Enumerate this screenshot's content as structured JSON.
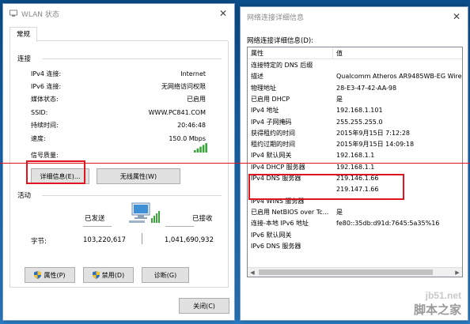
{
  "status_window": {
    "title": "WLAN 状态",
    "tab": "常规",
    "connection": {
      "title": "连接",
      "rows": [
        {
          "k": "IPv4 连接:",
          "v": "Internet"
        },
        {
          "k": "IPv6 连接:",
          "v": "无网络访问权限"
        },
        {
          "k": "媒体状态:",
          "v": "已启用"
        },
        {
          "k": "SSID:",
          "v": "WWW.PC841.COM"
        },
        {
          "k": "持续时间:",
          "v": "20:46:48"
        },
        {
          "k": "速度:",
          "v": "150.0 Mbps"
        }
      ],
      "signal_label": "信号质量:",
      "signal_bars": 5
    },
    "details_button": "详细信息(E)...",
    "wireless_props_button": "无线属性(W)",
    "activity": {
      "title": "活动",
      "sent_label": "已发送",
      "received_label": "已接收",
      "bytes_label": "字节:",
      "bytes_sent": "103,220,617",
      "bytes_received": "1,041,690,932"
    },
    "properties_button": "属性(P)",
    "disable_button": "禁用(D)",
    "diagnose_button": "诊断(G)",
    "close_button": "关闭(C)"
  },
  "details_window": {
    "title": "网络连接详细信息",
    "list_label": "网络连接详细信息(D):",
    "col_property": "属性",
    "col_value": "值",
    "rows": [
      {
        "k": "连接特定的 DNS 后缀",
        "v": ""
      },
      {
        "k": "描述",
        "v": "Qualcomm Atheros AR9485WB-EG Wire"
      },
      {
        "k": "物理地址",
        "v": "28-E3-47-42-AA-98"
      },
      {
        "k": "已启用 DHCP",
        "v": "是"
      },
      {
        "k": "IPv4 地址",
        "v": "192.168.1.101"
      },
      {
        "k": "IPv4 子网掩码",
        "v": "255.255.255.0"
      },
      {
        "k": "获得租约的时间",
        "v": "2015年9月15日 7:12:28"
      },
      {
        "k": "租约过期的时间",
        "v": "2015年9月15日 14:09:18"
      },
      {
        "k": "IPv4 默认网关",
        "v": "192.168.1.1"
      },
      {
        "k": "IPv4 DHCP 服务器",
        "v": "192.168.1.1"
      },
      {
        "k": "IPv4 DNS 服务器",
        "v": "219.146.1.66"
      },
      {
        "k": "",
        "v": "219.147.1.66"
      },
      {
        "k": "IPv4 WINS 服务器",
        "v": ""
      },
      {
        "k": "已启用 NetBIOS over Tc...",
        "v": "是"
      },
      {
        "k": "连接-本地 IPv6 地址",
        "v": "fe80::35db:d91d:7645:5a35%16"
      },
      {
        "k": "IPv6 默认网关",
        "v": ""
      },
      {
        "k": "IPv6 DNS 服务器",
        "v": ""
      }
    ]
  },
  "watermark": {
    "line1": "jb51.net",
    "line2": "脚本之家"
  },
  "colors": {
    "highlight": "#e0141e",
    "signal": "#3aa53a",
    "shield_blue": "#2d6fbf",
    "shield_yellow": "#f2c230"
  }
}
